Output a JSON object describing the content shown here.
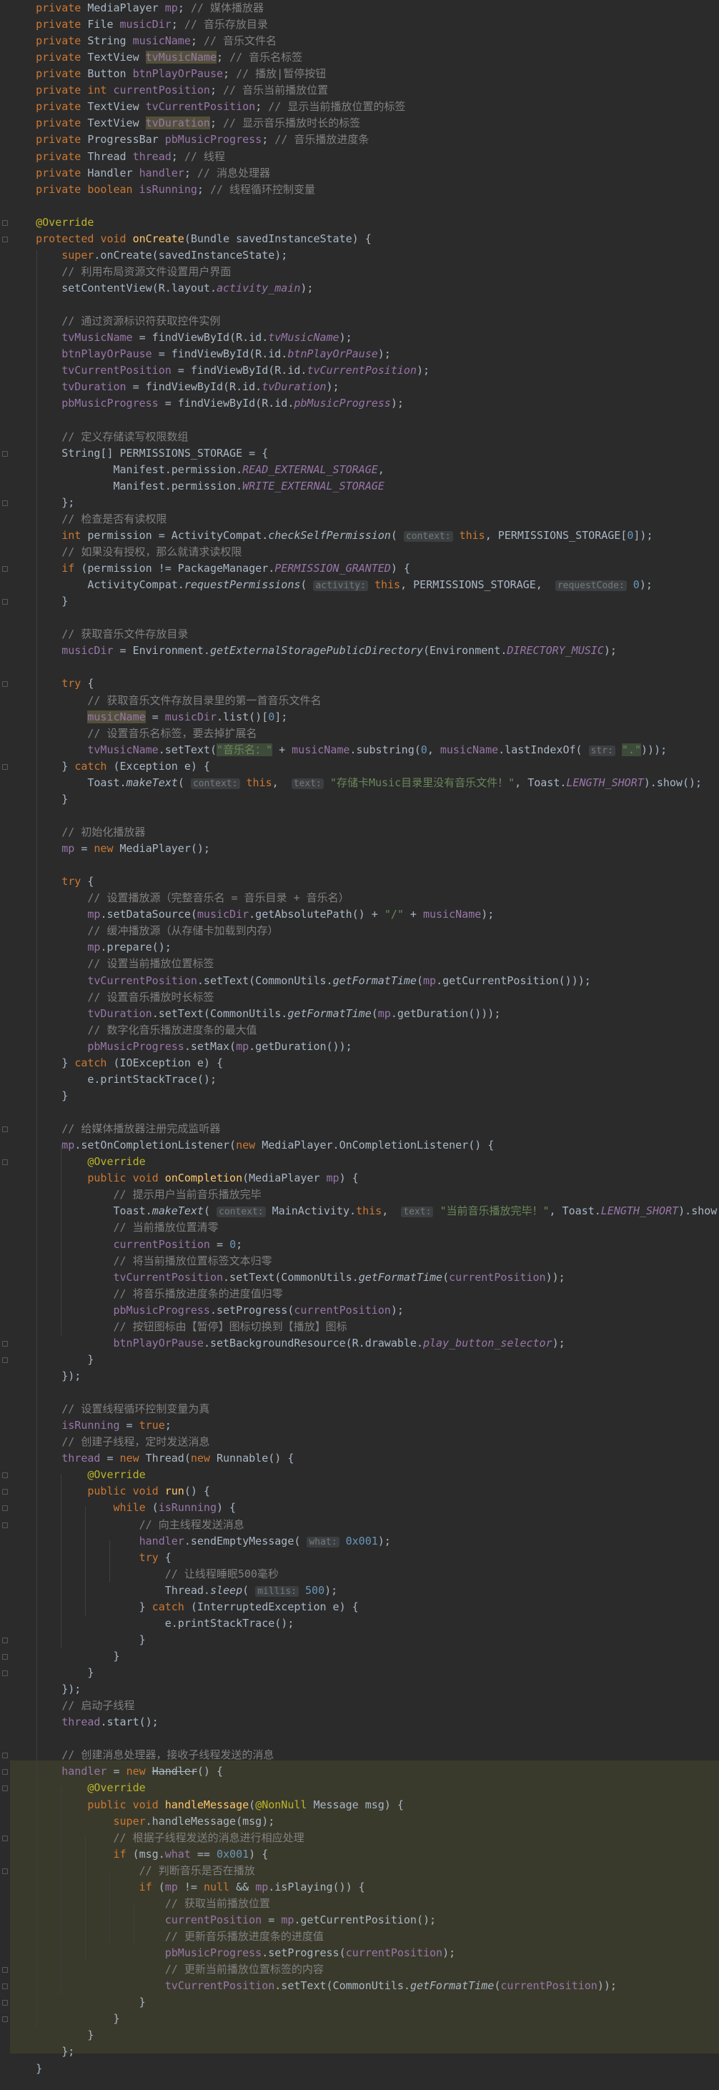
{
  "editor": {
    "language": "java",
    "colors": {
      "background": "#2b2b2b",
      "text": "#a9b7c6",
      "keyword": "#cc7832",
      "comment": "#808080",
      "field": "#9876aa",
      "method": "#ffc66d",
      "number": "#6897bb",
      "string": "#6a8759",
      "annotation": "#bbb529"
    },
    "lines": [
      "    private MediaPlayer mp; // 媒体播放器",
      "    private File musicDir; // 音乐存放目录",
      "    private String musicName; // 音乐文件名",
      "    private TextView tvMusicName; // 音乐名标签",
      "    private Button btnPlayOrPause; // 播放|暂停按钮",
      "    private int currentPosition; // 音乐当前播放位置",
      "    private TextView tvCurrentPosition; // 显示当前播放位置的标签",
      "    private TextView tvDuration; // 显示音乐播放时长的标签",
      "    private ProgressBar pbMusicProgress; // 音乐播放进度条",
      "    private Thread thread; // 线程",
      "    private Handler handler; // 消息处理器",
      "    private boolean isRunning; // 线程循环控制变量",
      "",
      "    @Override",
      "    protected void onCreate(Bundle savedInstanceState) {",
      "        super.onCreate(savedInstanceState);",
      "        // 利用布局资源文件设置用户界面",
      "        setContentView(R.layout.activity_main);",
      "",
      "        // 通过资源标识符获取控件实例",
      "        tvMusicName = findViewById(R.id.tvMusicName);",
      "        btnPlayOrPause = findViewById(R.id.btnPlayOrPause);",
      "        tvCurrentPosition = findViewById(R.id.tvCurrentPosition);",
      "        tvDuration = findViewById(R.id.tvDuration);",
      "        pbMusicProgress = findViewById(R.id.pbMusicProgress);",
      "",
      "        // 定义存储读写权限数组",
      "        String[] PERMISSIONS_STORAGE = {",
      "                Manifest.permission.READ_EXTERNAL_STORAGE,",
      "                Manifest.permission.WRITE_EXTERNAL_STORAGE",
      "        };",
      "        // 检查是否有读权限",
      "        int permission = ActivityCompat.checkSelfPermission( context: this, PERMISSIONS_STORAGE[0]);",
      "        // 如果没有授权，那么就请求读权限",
      "        if (permission != PackageManager.PERMISSION_GRANTED) {",
      "            ActivityCompat.requestPermissions( activity: this, PERMISSIONS_STORAGE,  requestCode: 0);",
      "        }",
      "",
      "        // 获取音乐文件存放目录",
      "        musicDir = Environment.getExternalStoragePublicDirectory(Environment.DIRECTORY_MUSIC);",
      "",
      "        try {",
      "            // 获取音乐文件存放目录里的第一首音乐文件名",
      "            musicName = musicDir.list()[0];",
      "            // 设置音乐名标签，要去掉扩展名",
      "            tvMusicName.setText(\"音乐名：\" + musicName.substring(0, musicName.lastIndexOf( str: \".\")));",
      "        } catch (Exception e) {",
      "            Toast.makeText( context: this,  text: \"存储卡Music目录里没有音乐文件！\", Toast.LENGTH_SHORT).show();",
      "        }",
      "",
      "        // 初始化播放器",
      "        mp = new MediaPlayer();",
      "",
      "        try {",
      "            // 设置播放源（完整音乐名 = 音乐目录 + 音乐名）",
      "            mp.setDataSource(musicDir.getAbsolutePath() + \"/\" + musicName);",
      "            // 缓冲播放源（从存储卡加载到内存）",
      "            mp.prepare();",
      "            // 设置当前播放位置标签",
      "            tvCurrentPosition.setText(CommonUtils.getFormatTime(mp.getCurrentPosition()));",
      "            // 设置音乐播放时长标签",
      "            tvDuration.setText(CommonUtils.getFormatTime(mp.getDuration()));",
      "            // 数字化音乐播放进度条的最大值",
      "            pbMusicProgress.setMax(mp.getDuration());",
      "        } catch (IOException e) {",
      "            e.printStackTrace();",
      "        }",
      "",
      "        // 给媒体播放器注册完成监听器",
      "        mp.setOnCompletionListener(new MediaPlayer.OnCompletionListener() {",
      "            @Override",
      "            public void onCompletion(MediaPlayer mp) {",
      "                // 提示用户当前音乐播放完毕",
      "                Toast.makeText( context: MainActivity.this,  text: \"当前音乐播放完毕！\", Toast.LENGTH_SHORT).show();",
      "                // 当前播放位置清零",
      "                currentPosition = 0;",
      "                // 将当前播放位置标签文本归零",
      "                tvCurrentPosition.setText(CommonUtils.getFormatTime(currentPosition));",
      "                // 将音乐播放进度条的进度值归零",
      "                pbMusicProgress.setProgress(currentPosition);",
      "                // 按钮图标由【暂停】图标切换到【播放】图标",
      "                btnPlayOrPause.setBackgroundResource(R.drawable.play_button_selector);",
      "            }",
      "        });",
      "",
      "        // 设置线程循环控制变量为真",
      "        isRunning = true;",
      "        // 创建子线程，定时发送消息",
      "        thread = new Thread(new Runnable() {",
      "            @Override",
      "            public void run() {",
      "                while (isRunning) {",
      "                    // 向主线程发送消息",
      "                    handler.sendEmptyMessage( what: 0x001);",
      "                    try {",
      "                        // 让线程睡眠500毫秒",
      "                        Thread.sleep( millis: 500);",
      "                    } catch (InterruptedException e) {",
      "                        e.printStackTrace();",
      "                    }",
      "                }",
      "            }",
      "        });",
      "        // 启动子线程",
      "        thread.start();",
      "",
      "        // 创建消息处理器，接收子线程发送的消息",
      "        handler = new Handler() {",
      "            @Override",
      "            public void handleMessage(@NonNull Message msg) {",
      "                super.handleMessage(msg);",
      "                // 根据子线程发送的消息进行相应处理",
      "                if (msg.what == 0x001) {",
      "                    // 判断音乐是否在播放",
      "                    if (mp != null && mp.isPlaying()) {",
      "                        // 获取当前播放位置",
      "                        currentPosition = mp.getCurrentPosition();",
      "                        // 更新音乐播放进度条的进度值",
      "                        pbMusicProgress.setProgress(currentPosition);",
      "                        // 更新当前播放位置标签的内容",
      "                        tvCurrentPosition.setText(CommonUtils.getFormatTime(currentPosition));",
      "                    }",
      "                }",
      "            }",
      "        };",
      "    }"
    ]
  }
}
